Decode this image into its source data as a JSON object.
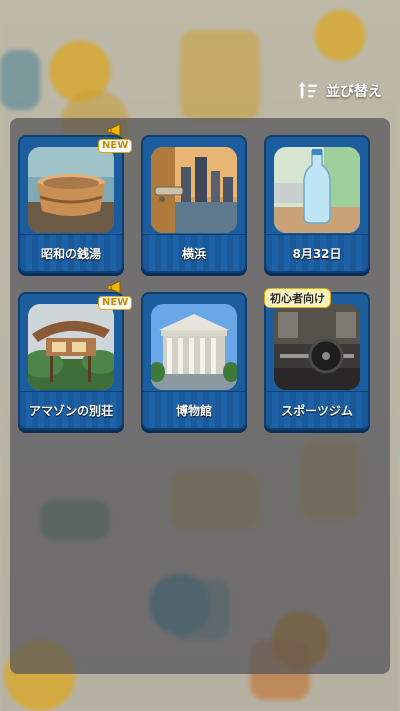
{
  "sort_button": {
    "label": "並び替え"
  },
  "rooms": [
    {
      "label": "昭和の銭湯",
      "badge": "NEW"
    },
    {
      "label": "横浜",
      "badge": ""
    },
    {
      "label": "8月32日",
      "badge": ""
    },
    {
      "label": "アマゾンの別荘",
      "badge": "NEW"
    },
    {
      "label": "博物館",
      "badge": ""
    },
    {
      "label": "スポーツジム",
      "badge": "初心者向け"
    }
  ],
  "colors": {
    "card": "#1c5d9e",
    "badge_gold": "#e6a800"
  }
}
